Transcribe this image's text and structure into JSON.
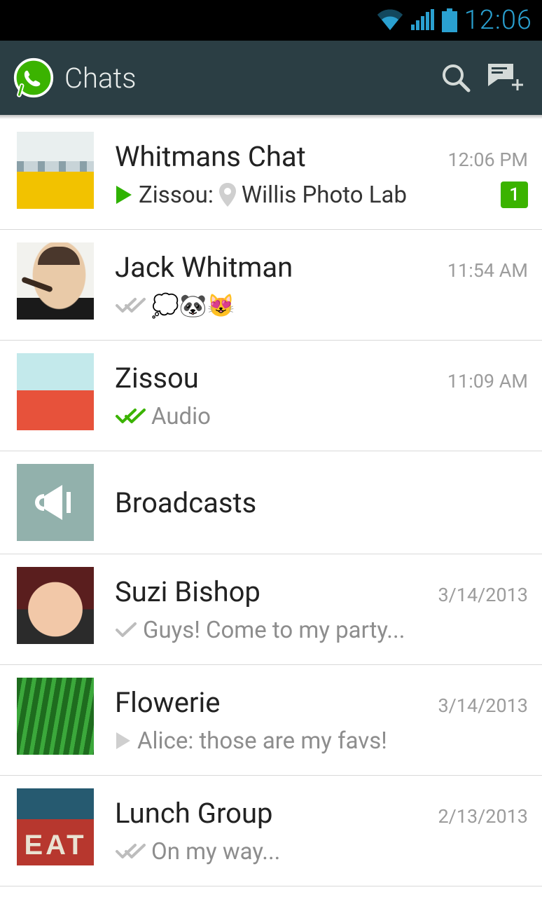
{
  "status": {
    "clock": "12:06"
  },
  "header": {
    "title": "Chats"
  },
  "chats": [
    {
      "name": "Whitmans Chat",
      "time": "12:06 PM",
      "sender": "Zissou:",
      "preview": "Willis Photo Lab",
      "avatar": "av-train",
      "marker": "play-green",
      "location": true,
      "unread": "1"
    },
    {
      "name": "Jack Whitman",
      "time": "11:54 AM",
      "preview": "💭🐼😻",
      "avatar": "av-jack",
      "marker": "tick-double-gray"
    },
    {
      "name": "Zissou",
      "time": "11:09 AM",
      "preview": "Audio",
      "avatar": "av-zissou",
      "marker": "tick-double-green"
    },
    {
      "name": "Broadcasts",
      "time": "",
      "preview": "",
      "avatar": "av-broadcast",
      "marker": "none"
    },
    {
      "name": "Suzi Bishop",
      "time": "3/14/2013",
      "preview": "Guys! Come to my party...",
      "avatar": "av-suzi",
      "marker": "tick-single-gray"
    },
    {
      "name": "Flowerie",
      "time": "3/14/2013",
      "sender": "Alice:",
      "preview": "those are my favs!",
      "avatar": "av-flower",
      "marker": "play-gray"
    },
    {
      "name": "Lunch Group",
      "time": "2/13/2013",
      "preview": "On my way...",
      "avatar": "av-lunch",
      "marker": "tick-double-gray"
    }
  ]
}
